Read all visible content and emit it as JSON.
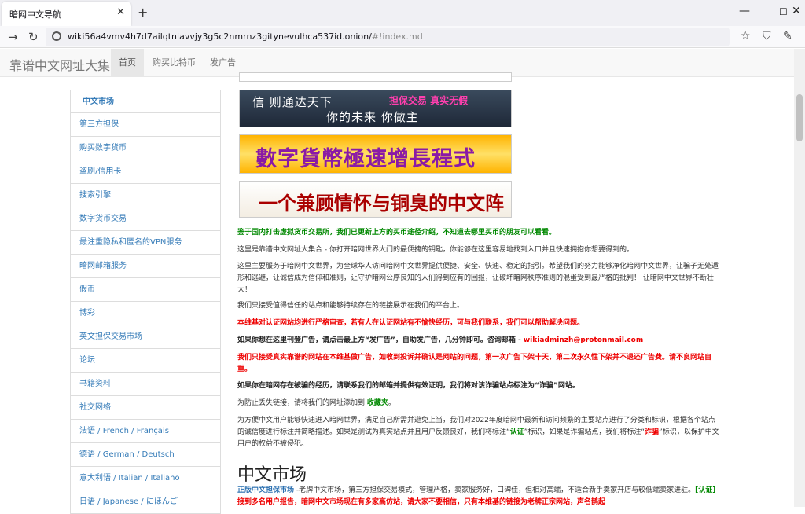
{
  "browser": {
    "tab_title": "暗网中文导航",
    "url": "wiki56a4vmv4h7d7ailqtniavvjy3g5c2nmrnz3gitynevulhca537id.onion/",
    "url_fragment": "#!index.md"
  },
  "site": {
    "brand": "靠谱中文网址大集合",
    "nav": [
      "首页",
      "购买比特币",
      "发广告"
    ]
  },
  "sidebar": [
    "中文市场",
    "第三方担保",
    "购买数字货币",
    "盗刷/信用卡",
    "搜索引擎",
    "数字货币交易",
    "最注重隐私和匿名的VPN服务",
    "暗网邮箱服务",
    "假币",
    "博彩",
    "英文担保交易市场",
    "论坛",
    "书籍资料",
    "社交网络",
    "法语 / French / Français",
    "德语 / German / Deutsch",
    "意大利语 / Italian / Italiano",
    "日语 / Japanese / にほんご"
  ],
  "banners": {
    "b2_l1": "信 则通达天下",
    "b2_l2": "你的未来 你做主",
    "b2_l3": "担保交易 真实无假",
    "b3": "數字貨幣極速增長程式",
    "b4": "一个兼顾情怀与铜臭的中文阵地"
  },
  "main": {
    "p0": "鉴于国内打击虚拟货币交易所，我们已更新上方的买币途径介绍，不知道去哪里买币的朋友可以看看。",
    "p1": "这里是靠谱中文网址大集合 - 你打开暗网世界大门的最便捷的钥匙，你能够在这里容易地找到入口并且快速拥抱你想要得到的。",
    "p2": "这里主要服务于暗网中文世界，为全球华人访问暗网中文世界提供便捷、安全、快速、稳定的指引。希望我们的努力能够净化暗网中文世界，让骗子无处遁形和逃避，让诚信成为信仰和准则，让守护暗网公序良知的人们得到应有的回报，让破坏暗网秩序准则的混蛋受到最严格的批判！ 让暗网中文世界不断壮大！",
    "p3": "我们只接受值得信任的站点和能够持续存在的链接展示在我们的平台上。",
    "p4": "本维基对认证网站均进行严格审查，若有人在认证网站有不愉快经历，可与我们联系，我们可以帮助解决问题。",
    "p5a": "如果你想在这里刊登广告，请点击最上方“发广告”，自助发广告，几分钟即可。咨询邮箱 - ",
    "p5b": "wikiadminzh@protonmail.com",
    "p6": "我们只接受真实靠谱的网站在本维基做广告，如收到投诉并确认是网站的问题，第一次广告下架十天，第二次永久性下架并不退还广告费。请不良网站自重。",
    "p7": "如果你在暗网存在被骗的经历，请联系我们的邮箱并提供有效证明，我们将对该诈骗站点标注为“诈骗”网站。",
    "p8a": "为防止丢失链接，请将我们的网址添加到 ",
    "p8b": "收藏夹",
    "p8c": "。",
    "p9a": "为方便中文用户能够快速进入暗网世界，满足自己所需并避免上当，我们对2022年度暗网中最新和访问频繁的主要站点进行了分类和标识，根据各个站点的诚信度进行标注并简略描述。如果是测试为真实站点并且用户反馈良好，我们将标注“",
    "p9b": "认证",
    "p9c": "”标识，如果是诈骗站点，我们将标注“",
    "p9d": "诈骗",
    "p9e": "”标识，以保护中文用户的权益不被侵犯。",
    "h2": "中文市场",
    "p10a": "正版中文担保市场",
    "p10b": " -老牌中文市场，第三方担保交易模式，管理严格，卖家服务好，口碑佳，但相对高端，不适合新手卖家开店与较低端卖家进驻。",
    "p10c": "[认证]",
    "p10d": "接到多名用户报告，暗网中文市场现在有多家高仿站，请大家不要相信，只有本维基的链接为老牌正宗网站，声名鹊起"
  }
}
